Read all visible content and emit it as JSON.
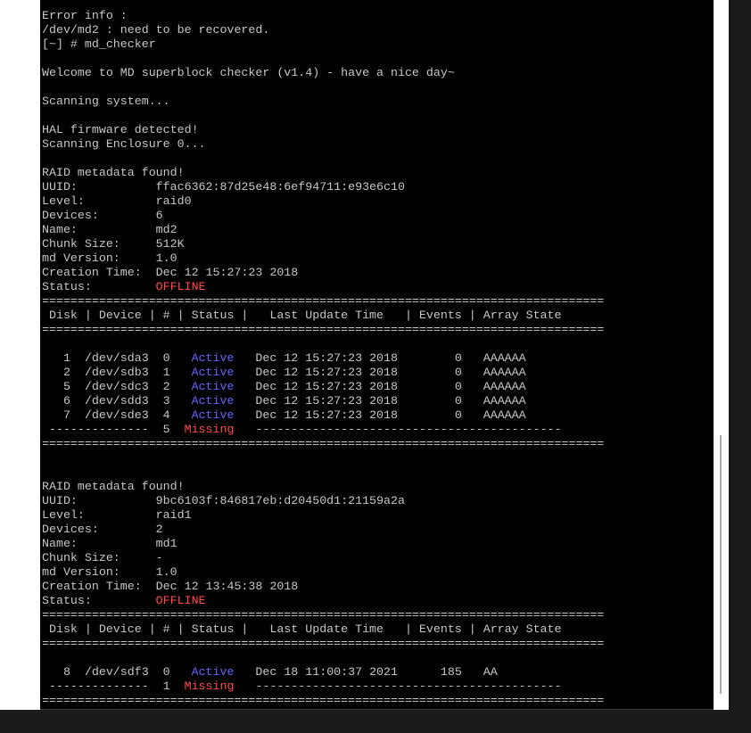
{
  "terminal": {
    "lines": [
      "Error info :",
      "/dev/md2 : need to be recovered.",
      "[~] # md_checker",
      "",
      "Welcome to MD superblock checker (v1.4) - have a nice day~",
      "",
      "Scanning system...",
      "",
      "HAL firmware detected!",
      "Scanning Enclosure 0...",
      "",
      "RAID metadata found!",
      "UUID:           ffac6362:87d25e48:6ef94711:e93e6c10",
      "Level:          raid0",
      "Devices:        6",
      "Name:           md2",
      "Chunk Size:     512K",
      "md Version:     1.0",
      "Creation Time:  Dec 12 15:27:23 2018",
      "Status:         OFFLINE",
      "===============================================================================",
      " Disk | Device | # | Status |   Last Update Time   | Events | Array State",
      "===============================================================================",
      "",
      "   1  /dev/sda3  0   Active   Dec 12 15:27:23 2018        0   AAAAAA",
      "   2  /dev/sdb3  1   Active   Dec 12 15:27:23 2018        0   AAAAAA",
      "   5  /dev/sdc3  2   Active   Dec 12 15:27:23 2018        0   AAAAAA",
      "   6  /dev/sdd3  3   Active   Dec 12 15:27:23 2018        0   AAAAAA",
      "   7  /dev/sde3  4   Active   Dec 12 15:27:23 2018        0   AAAAAA",
      " --------------  5  Missing   -------------------------------------------",
      "===============================================================================",
      "",
      "",
      "RAID metadata found!",
      "UUID:           9bc6103f:846817eb:d20450d1:21159a2a",
      "Level:          raid1",
      "Devices:        2",
      "Name:           md1",
      "Chunk Size:     -",
      "md Version:     1.0",
      "Creation Time:  Dec 12 13:45:38 2018",
      "Status:         OFFLINE",
      "===============================================================================",
      " Disk | Device | # | Status |   Last Update Time   | Events | Array State",
      "===============================================================================",
      "",
      "   8  /dev/sdf3  0   Active   Dec 18 11:00:37 2021      185   AA",
      " --------------  1  Missing   -------------------------------------------",
      "===============================================================================",
      "",
      "",
      "[~] # "
    ],
    "colors": {
      "background": "#000000",
      "text": "#c8c8c8",
      "offline": "#ff4d4d",
      "missing": "#ff4d4d",
      "active": "#6666ff",
      "cursor": "#2ed12e"
    }
  }
}
